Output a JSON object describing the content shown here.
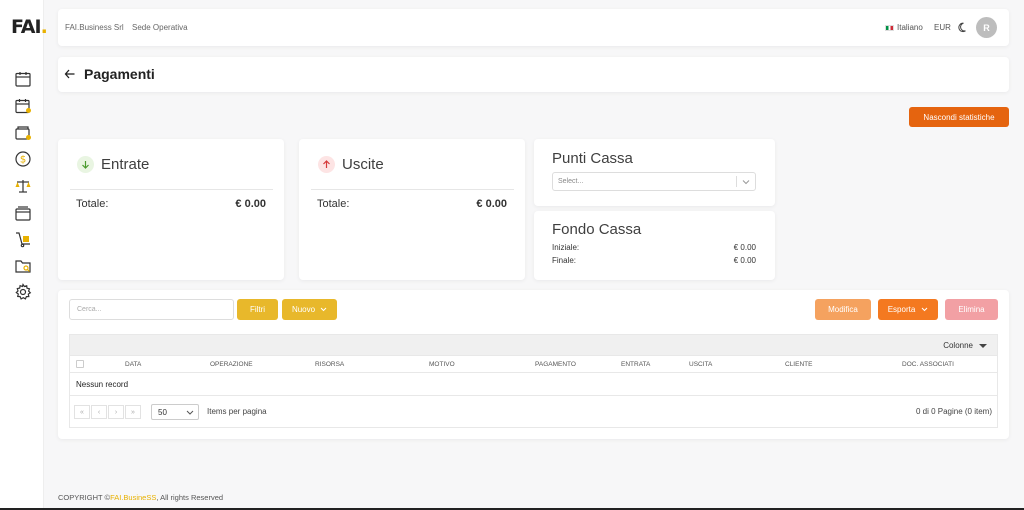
{
  "app": {
    "logo_text": "FAI",
    "logo_dot": "."
  },
  "sidebar": {
    "items": [
      {
        "icon": "calendar-icon"
      },
      {
        "icon": "calendar-user-icon"
      },
      {
        "icon": "wallet-icon"
      },
      {
        "icon": "dollar-coin-icon"
      },
      {
        "icon": "scale-icon"
      },
      {
        "icon": "cash-register-icon"
      },
      {
        "icon": "hand-truck-icon"
      },
      {
        "icon": "folder-search-icon"
      },
      {
        "icon": "settings-gear-icon"
      }
    ]
  },
  "header": {
    "company": "FAI.Business Srl",
    "location": "Sede Operativa",
    "language": "Italiano",
    "currency": "EUR",
    "avatar_initial": "R"
  },
  "page": {
    "title": "Pagamenti",
    "hide_stats_label": "Nascondi statistiche"
  },
  "stats": {
    "entrate": {
      "title": "Entrate",
      "total_label": "Totale:",
      "total_value": "€ 0.00"
    },
    "uscite": {
      "title": "Uscite",
      "total_label": "Totale:",
      "total_value": "€ 0.00"
    },
    "punti_cassa": {
      "title": "Punti Cassa",
      "select_placeholder": "Select..."
    },
    "fondo_cassa": {
      "title": "Fondo Cassa",
      "initial_label": "Iniziale:",
      "initial_value": "€ 0.00",
      "final_label": "Finale:",
      "final_value": "€ 0.00"
    }
  },
  "toolbar": {
    "search_placeholder": "Cerca...",
    "filters_label": "Filtri",
    "new_label": "Nuovo",
    "edit_label": "Modifica",
    "export_label": "Esporta",
    "delete_label": "Elimina"
  },
  "table": {
    "columns_button": "Colonne",
    "columns": [
      "DATA",
      "OPERAZIONE",
      "RISORSA",
      "MOTIVO",
      "PAGAMENTO",
      "ENTRATA",
      "USCITA",
      "CLIENTE",
      "DOC. ASSOCIATI"
    ],
    "empty_message": "Nessun record",
    "page_size": "50",
    "page_size_label": "Items per pagina",
    "page_info": "0 di 0 Pagine (0 item)",
    "pager_buttons": [
      "«",
      "‹",
      "›",
      "»"
    ]
  },
  "footer": {
    "prefix": "COPYRIGHT ©",
    "brand": "FAI.BusineSS",
    "suffix": ", All rights Reserved"
  },
  "colors": {
    "accent_yellow": "#e8b100",
    "accent_orange": "#e5640f",
    "edit_orange_light": "#f5a25f",
    "export_orange": "#f47920",
    "delete_pink": "#f2a0a4"
  }
}
